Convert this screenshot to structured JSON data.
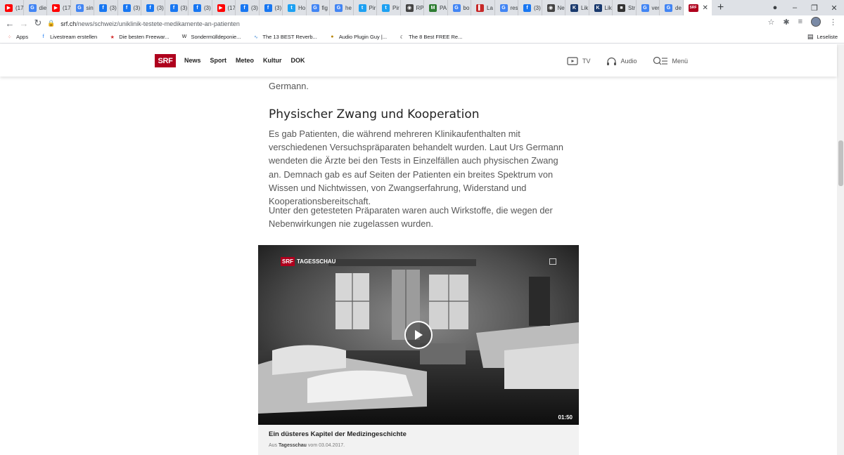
{
  "browser": {
    "tabs": [
      {
        "icon": "youtube-icon",
        "color": "#ff0000",
        "title": "(17"
      },
      {
        "icon": "google-icon",
        "color": "#4285f4",
        "title": "die"
      },
      {
        "icon": "youtube-icon",
        "color": "#ff0000",
        "title": "(17"
      },
      {
        "icon": "google-icon",
        "color": "#4285f4",
        "title": "sin"
      },
      {
        "icon": "facebook-icon",
        "color": "#1877f2",
        "title": "(3)"
      },
      {
        "icon": "facebook-icon",
        "color": "#1877f2",
        "title": "(3)"
      },
      {
        "icon": "facebook-icon",
        "color": "#1877f2",
        "title": "(3)"
      },
      {
        "icon": "facebook-icon",
        "color": "#1877f2",
        "title": "(3)"
      },
      {
        "icon": "facebook-icon",
        "color": "#1877f2",
        "title": "(3)"
      },
      {
        "icon": "youtube-icon",
        "color": "#ff0000",
        "title": "(17"
      },
      {
        "icon": "facebook-icon",
        "color": "#1877f2",
        "title": "(3)"
      },
      {
        "icon": "facebook-icon",
        "color": "#1877f2",
        "title": "(3)"
      },
      {
        "icon": "twitter-icon",
        "color": "#1da1f2",
        "title": "Ho"
      },
      {
        "icon": "google-icon",
        "color": "#4285f4",
        "title": "fig"
      },
      {
        "icon": "google-icon",
        "color": "#4285f4",
        "title": "he"
      },
      {
        "icon": "twitter-icon",
        "color": "#1da1f2",
        "title": "Pir"
      },
      {
        "icon": "twitter-icon",
        "color": "#1da1f2",
        "title": "Pir"
      },
      {
        "icon": "globe-icon",
        "color": "#444444",
        "title": "RP"
      },
      {
        "icon": "pa-icon",
        "color": "#2e7d32",
        "title": "PA"
      },
      {
        "icon": "google-icon",
        "color": "#4285f4",
        "title": "bo"
      },
      {
        "icon": "la-icon",
        "color": "#c62828",
        "title": "La"
      },
      {
        "icon": "google-icon",
        "color": "#4285f4",
        "title": "res"
      },
      {
        "icon": "facebook-icon",
        "color": "#1877f2",
        "title": "(3)"
      },
      {
        "icon": "globe-icon",
        "color": "#444444",
        "title": "Ne"
      },
      {
        "icon": "k-icon",
        "color": "#1a3a6e",
        "title": "Lik"
      },
      {
        "icon": "k-icon",
        "color": "#1a3a6e",
        "title": "Lik"
      },
      {
        "icon": "str-icon",
        "color": "#333333",
        "title": "Str"
      },
      {
        "icon": "google-icon",
        "color": "#4285f4",
        "title": "ver"
      },
      {
        "icon": "google-icon",
        "color": "#4285f4",
        "title": "de"
      }
    ],
    "active_tab": {
      "icon": "srf-icon",
      "color": "#af001d",
      "label": "SRF"
    },
    "new_tab": "+",
    "window_controls": [
      "●",
      "–",
      "❐",
      "✕"
    ],
    "url_host": "srf.ch",
    "url_path": "/news/schweiz/uniklinik-testete-medikamente-an-patienten",
    "bookmarks": [
      {
        "icon": "apps-icon",
        "label": "Apps"
      },
      {
        "icon": "facebook-icon",
        "label": "Livestream erstellen"
      },
      {
        "icon": "star-icon",
        "label": "Die besten Freewar..."
      },
      {
        "icon": "wikipedia-icon",
        "label": "Sondermülldeponie..."
      },
      {
        "icon": "reverb-icon",
        "label": "The 13 BEST Reverb..."
      },
      {
        "icon": "plugin-icon",
        "label": "Audio Plugin Guy |..."
      },
      {
        "icon": "moon-icon",
        "label": "The 8 Best FREE Re..."
      }
    ],
    "reading_list": "Leseliste"
  },
  "srf": {
    "logo": "SRF",
    "nav": [
      "News",
      "Sport",
      "Meteo",
      "Kultur",
      "DOK"
    ],
    "tv_label": "TV",
    "audio_label": "Audio",
    "menu_label": "Menü"
  },
  "article": {
    "prev_tail": "Germann.",
    "heading": "Physischer Zwang und Kooperation",
    "para1": "Es gab Patienten, die während mehreren Klinikaufenthalten mit verschiedenen Versuchspräparaten behandelt wurden. Laut Urs Germann wendeten die Ärzte bei den Tests in Einzelfällen auch physischen Zwang an. Demnach gab es auf Seiten der Patienten ein breites Spektrum von Wissen und Nichtwissen, von Zwangserfahrung, Widerstand und Kooperationsbereitschaft.",
    "para2": "Unter den getesteten Präparaten waren auch Wirkstoffe, die wegen der Nebenwirkungen nie zugelassen wurden."
  },
  "video": {
    "brand_logo": "SRF",
    "brand_show": "TAGESSCHAU",
    "duration": "01:50",
    "title": "Ein düsteres Kapitel der Medizingeschichte",
    "meta_prefix": "Aus",
    "meta_show": "Tagesschau",
    "meta_suffix": "vom 03.04.2017."
  }
}
